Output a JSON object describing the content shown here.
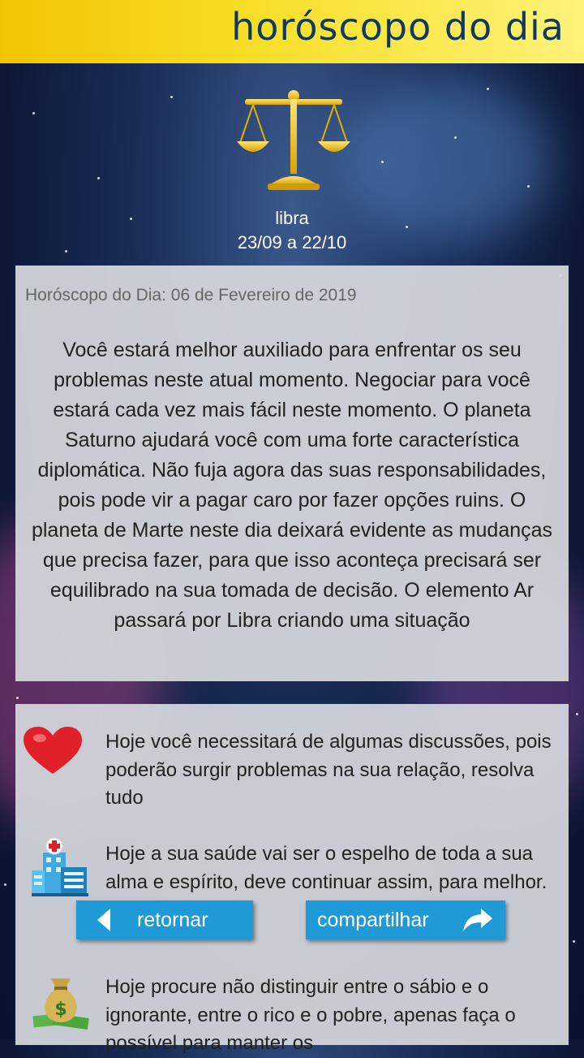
{
  "header": {
    "title": "horóscopo do dia"
  },
  "sign": {
    "name": "libra",
    "dates": "23/09 a 22/10",
    "icon": "libra-scales-icon"
  },
  "reading": {
    "date_label": "Horóscopo do Dia: 06 de Fevereiro de 2019",
    "text": "Você estará melhor auxiliado para enfrentar os seu problemas neste atual momento. Negociar para você estará cada vez mais fácil neste momento. O planeta Saturno ajudará você com uma forte característica diplomática. Não fuja agora das suas responsabilidades, pois pode vir a pagar caro por fazer opções ruins. O planeta de Marte neste dia deixará evidente as mudanças que precisa fazer, para que isso aconteça precisará ser equilibrado na sua tomada de decisão. O elemento Ar passará por Libra criando uma situação"
  },
  "categories": [
    {
      "icon": "heart-icon",
      "text": " Hoje você necessitará de algumas discussões, pois poderão surgir problemas na sua relação, resolva tudo"
    },
    {
      "icon": "hospital-icon",
      "text": " Hoje a sua saúde vai ser o espelho de toda a sua alma e espírito, deve continuar assim, para melhor."
    },
    {
      "icon": "money-bag-icon",
      "text": " Hoje procure não distinguir entre o sábio e o ignorante, entre o rico e o pobre, apenas faça o possível para manter os"
    }
  ],
  "buttons": {
    "back": "retornar",
    "share": "compartilhar"
  },
  "colors": {
    "header": "#f8df2a",
    "title": "#0f3a5e",
    "button": "#1f9ad6",
    "heart": "#e0202a"
  }
}
